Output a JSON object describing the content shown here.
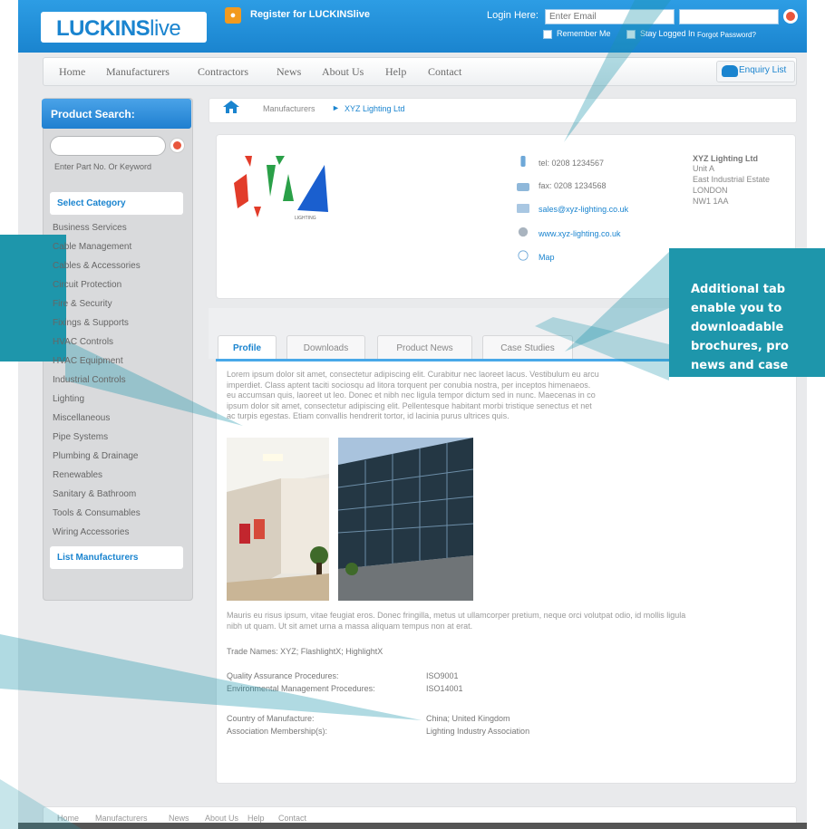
{
  "header": {
    "logo_bold": "LUCKINS",
    "logo_light": "live",
    "register": "Register for LUCKINSlive",
    "login_label": "Login Here:",
    "email_placeholder": "Enter Email",
    "remember": "Remember Me",
    "stay": "Stay Logged In",
    "forgot": "Forgot Password?"
  },
  "nav": {
    "items": [
      "Home",
      "Manufacturers",
      "Contractors",
      "News",
      "About Us",
      "Help",
      "Contact"
    ],
    "enquiry": "Enquiry List"
  },
  "sidebar": {
    "title": "Product Search:",
    "hint": "Enter Part No. Or Keyword",
    "select_category": "Select Category",
    "categories": [
      "Business Services",
      "Cable Management",
      "Cables & Accessories",
      "Circuit Protection",
      "Fire & Security",
      "Fixings & Supports",
      "HVAC Controls",
      "HVAC Equipment",
      "Industrial Controls",
      "Lighting",
      "Miscellaneous",
      "Pipe Systems",
      "Plumbing & Drainage",
      "Renewables",
      "Sanitary & Bathroom",
      "Tools & Consumables",
      "Wiring Accessories"
    ],
    "list_manufacturers": "List Manufacturers"
  },
  "breadcrumb": {
    "level1": "Manufacturers",
    "level2": "XYZ Lighting Ltd"
  },
  "company": {
    "logo_text": "LIGHTING",
    "tel": "tel: 0208 1234567",
    "fax": "fax: 0208 1234568",
    "email": "sales@xyz-lighting.co.uk",
    "web": "www.xyz-lighting.co.uk",
    "map": "Map",
    "name": "XYZ Lighting Ltd",
    "address": [
      "Unit A",
      "East Industrial Estate",
      "LONDON",
      "NW1 1AA"
    ]
  },
  "tabs": [
    "Profile",
    "Downloads",
    "Product News",
    "Case Studies"
  ],
  "profile": {
    "para1": [
      "Lorem ipsum dolor sit amet, consectetur adipiscing elit. Curabitur nec laoreet lacus. Vestibulum eu arcu",
      "imperdiet. Class aptent taciti sociosqu ad litora torquent per conubia nostra, per inceptos himenaeos.",
      "eu accumsan quis, laoreet ut leo. Donec et nibh nec ligula tempor dictum sed in nunc. Maecenas in co",
      "ipsum dolor sit amet, consectetur adipiscing elit. Pellentesque habitant morbi tristique senectus et net",
      "ac turpis egestas. Etiam convallis hendrerit tortor, id lacinia purus ultrices quis."
    ],
    "para2": [
      "Mauris eu risus ipsum, vitae feugiat eros. Donec fringilla, metus ut ullamcorper pretium, neque orci volutpat odio, id mollis ligula",
      "nibh ut quam. Ut sit amet urna a massa aliquam tempus non at erat."
    ],
    "trade_names": "Trade Names: XYZ; FlashlightX; HighlightX",
    "qa_label": "Quality Assurance Procedures:",
    "qa_value": "ISO9001",
    "env_label": "Environmental Management Procedures:",
    "env_value": "ISO14001",
    "country_label": "Country of Manufacture:",
    "country_value": "China; United Kingdom",
    "assoc_label": "Association Membership(s):",
    "assoc_value": "Lighting Industry Association"
  },
  "footer": {
    "items": [
      "Home",
      "Manufacturers",
      "News",
      "About Us",
      "Help",
      "Contact"
    ]
  },
  "callout": {
    "lines": [
      "Additional tab",
      "enable you to",
      "downloadable",
      "brochures, pro",
      "news and case"
    ]
  },
  "colors": {
    "brand_blue": "#1a84cf",
    "callout_teal": "#1e96ab",
    "accent_red": "#e8563c"
  }
}
